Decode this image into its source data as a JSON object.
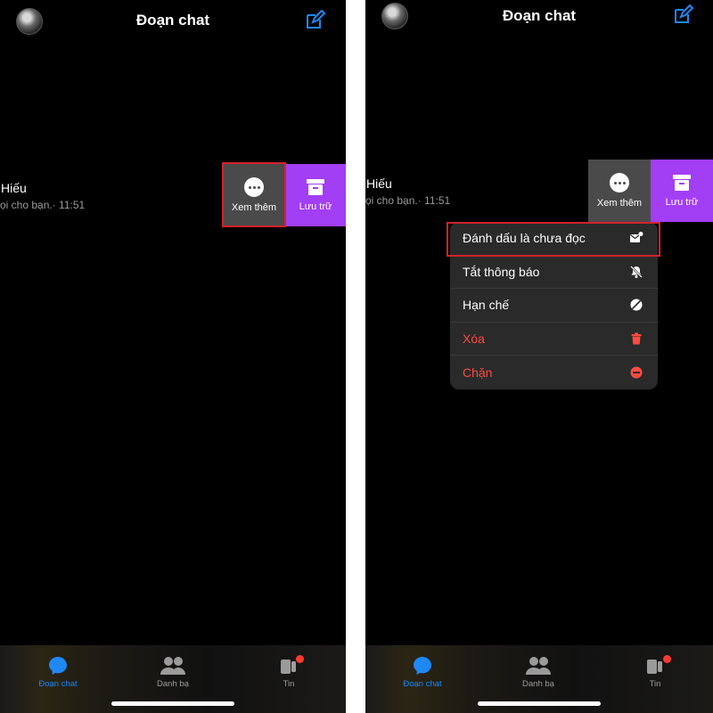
{
  "header": {
    "title": "Đoạn chat"
  },
  "contact": {
    "name": "Hiếu",
    "preview_left": "ọi cho bạn.· 11:51",
    "preview_right": "ọi cho bạn.· 11:51"
  },
  "swipe": {
    "more_label": "Xem thêm",
    "archive_label": "Lưu trữ"
  },
  "menu": {
    "items": [
      {
        "label": "Đánh dấu là chưa đọc",
        "icon": "mark-unread-icon"
      },
      {
        "label": "Tắt thông báo",
        "icon": "bell-off-icon"
      },
      {
        "label": "Hạn chế",
        "icon": "restrict-icon"
      },
      {
        "label": "Xóa",
        "icon": "trash-icon"
      },
      {
        "label": "Chặn",
        "icon": "block-icon"
      }
    ]
  },
  "tabs": [
    {
      "label": "Đoạn chat",
      "icon": "chat-bubble-icon"
    },
    {
      "label": "Danh bạ",
      "icon": "people-icon"
    },
    {
      "label": "Tin",
      "icon": "stories-icon"
    }
  ],
  "colors": {
    "accent": "#1e88f5",
    "archive": "#a23ef3",
    "danger": "#ff4b42",
    "highlight": "#d6202a"
  }
}
